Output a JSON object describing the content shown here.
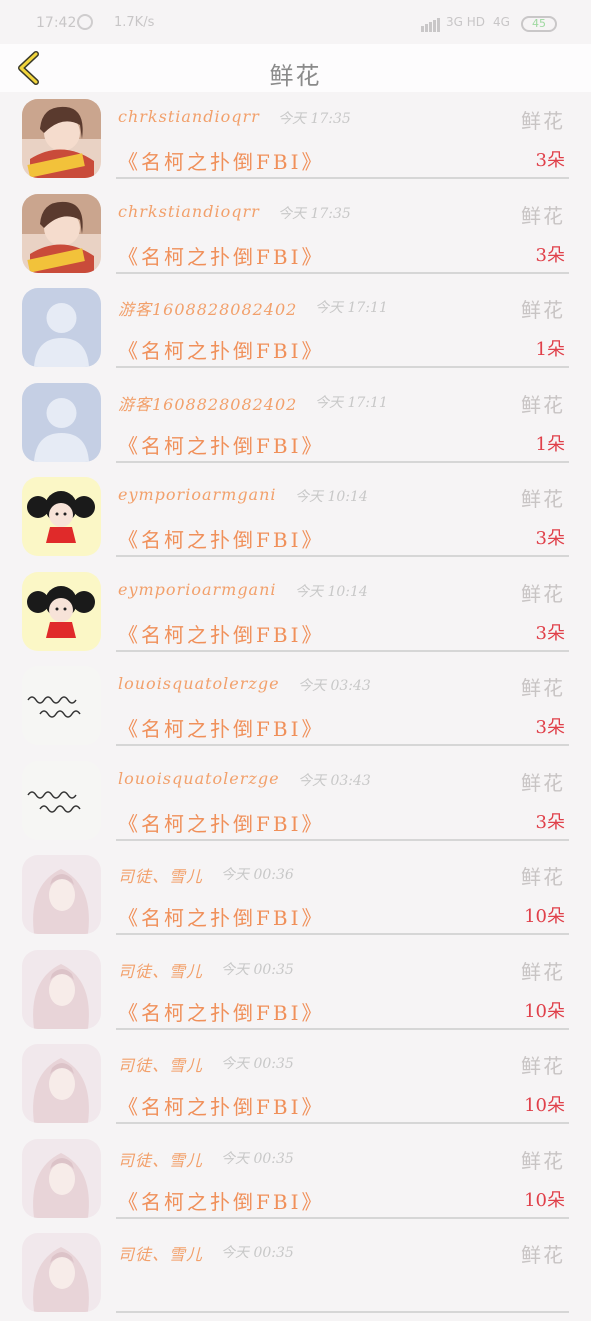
{
  "status_bar": {
    "time": "17:42",
    "net_speed": "1.7K/s",
    "network1": "3G HD",
    "network2": "4G",
    "battery": "45"
  },
  "header": {
    "title": "鲜花"
  },
  "colors": {
    "name": "#f2a06b",
    "count": "#e0404a",
    "book": "#f0905a"
  },
  "rows": [
    {
      "name": "chrkstiandioqrr",
      "time": "今天 17:35",
      "tag": "鲜花",
      "book": "《名柯之扑倒FBI》",
      "count": "3朵",
      "avatar": "girl-photo"
    },
    {
      "name": "chrkstiandioqrr",
      "time": "今天 17:35",
      "tag": "鲜花",
      "book": "《名柯之扑倒FBI》",
      "count": "3朵",
      "avatar": "girl-photo"
    },
    {
      "name": "游客1608828082402",
      "time": "今天 17:11",
      "tag": "鲜花",
      "book": "《名柯之扑倒FBI》",
      "count": "1朵",
      "avatar": "default-user"
    },
    {
      "name": "游客1608828082402",
      "time": "今天 17:11",
      "tag": "鲜花",
      "book": "《名柯之扑倒FBI》",
      "count": "1朵",
      "avatar": "default-user"
    },
    {
      "name": "eymporioarmgani",
      "time": "今天 10:14",
      "tag": "鲜花",
      "book": "《名柯之扑倒FBI》",
      "count": "3朵",
      "avatar": "cartoon-girl"
    },
    {
      "name": "eymporioarmgani",
      "time": "今天 10:14",
      "tag": "鲜花",
      "book": "《名柯之扑倒FBI》",
      "count": "3朵",
      "avatar": "cartoon-girl"
    },
    {
      "name": "louoisquatolerzge",
      "time": "今天 03:43",
      "tag": "鲜花",
      "book": "《名柯之扑倒FBI》",
      "count": "3朵",
      "avatar": "handwriting"
    },
    {
      "name": "louoisquatolerzge",
      "time": "今天 03:43",
      "tag": "鲜花",
      "book": "《名柯之扑倒FBI》",
      "count": "3朵",
      "avatar": "handwriting"
    },
    {
      "name": "司徒、雪儿",
      "time": "今天 00:36",
      "tag": "鲜花",
      "book": "《名柯之扑倒FBI》",
      "count": "10朵",
      "avatar": "anime-girl"
    },
    {
      "name": "司徒、雪儿",
      "time": "今天 00:35",
      "tag": "鲜花",
      "book": "《名柯之扑倒FBI》",
      "count": "10朵",
      "avatar": "anime-girl"
    },
    {
      "name": "司徒、雪儿",
      "time": "今天 00:35",
      "tag": "鲜花",
      "book": "《名柯之扑倒FBI》",
      "count": "10朵",
      "avatar": "anime-girl"
    },
    {
      "name": "司徒、雪儿",
      "time": "今天 00:35",
      "tag": "鲜花",
      "book": "《名柯之扑倒FBI》",
      "count": "10朵",
      "avatar": "anime-girl"
    },
    {
      "name": "司徒、雪儿",
      "time": "今天 00:35",
      "tag": "鲜花",
      "book": "",
      "count": "",
      "avatar": "anime-girl"
    }
  ]
}
